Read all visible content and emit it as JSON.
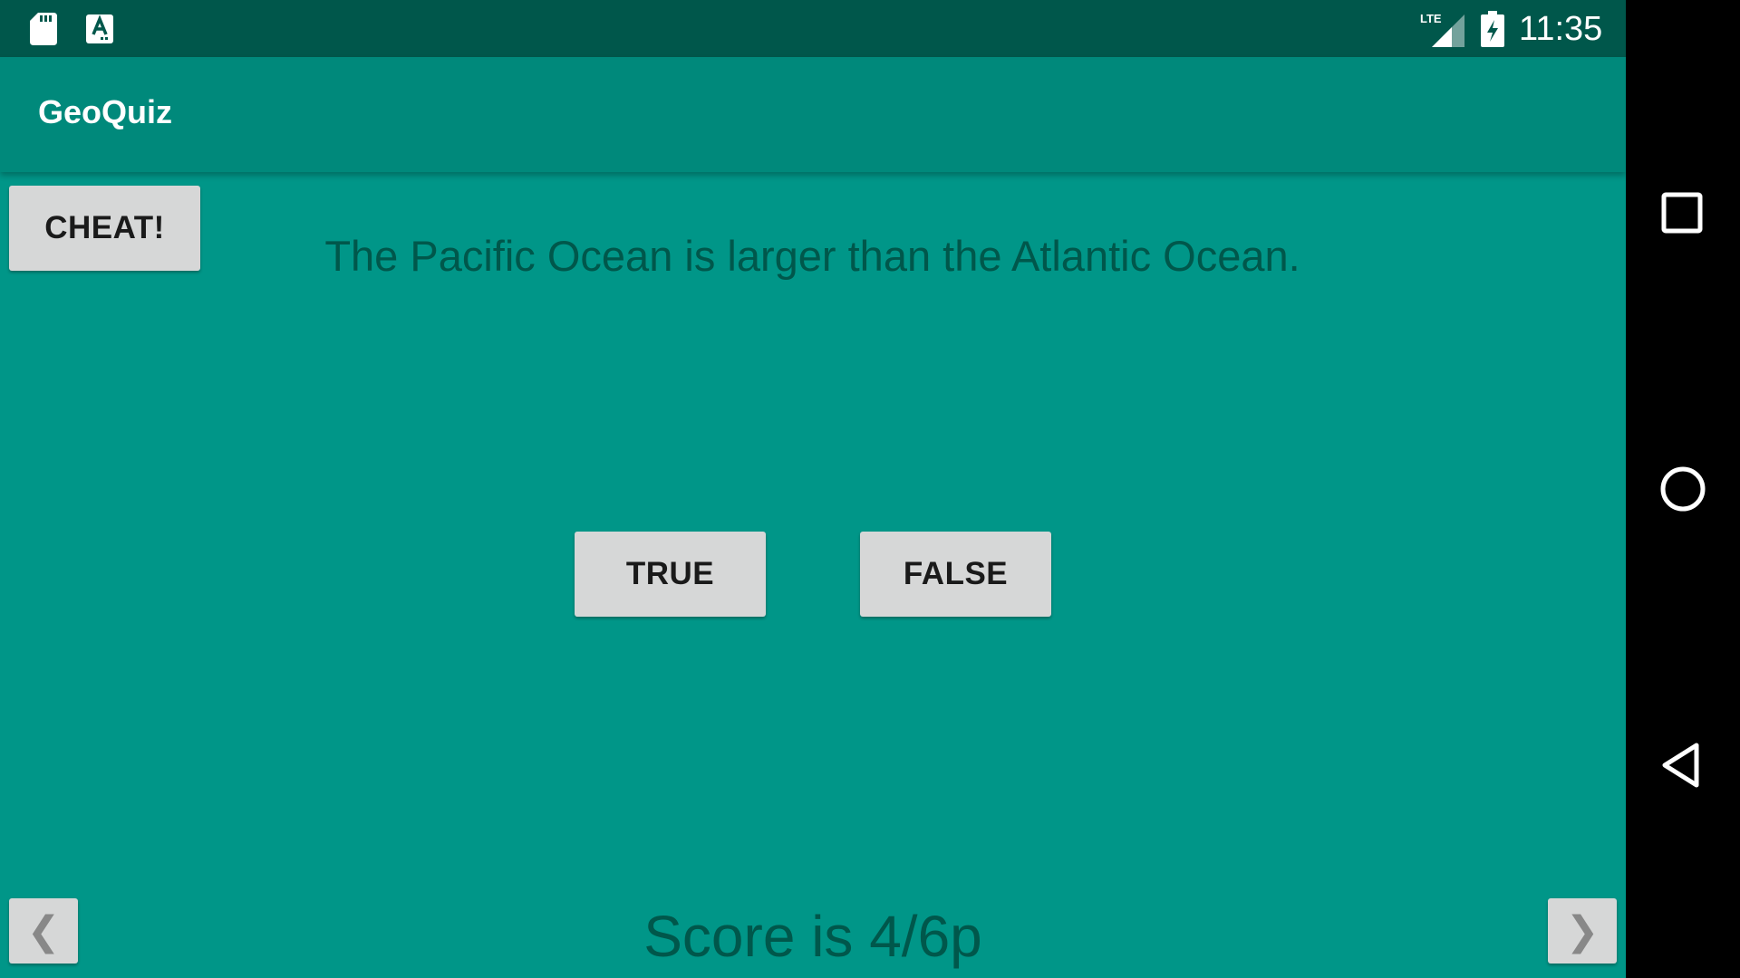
{
  "status_bar": {
    "time": "11:35",
    "network_label": "LTE",
    "icons": [
      "sd-card-icon",
      "text-a-icon",
      "lte-signal-icon",
      "battery-charging-icon"
    ]
  },
  "app_bar": {
    "title": "GeoQuiz"
  },
  "main": {
    "cheat_label": "CHEAT!",
    "question": "The Pacific Ocean is larger than the Atlantic Ocean.",
    "true_label": "TRUE",
    "false_label": "FALSE",
    "prev_glyph": "❮",
    "next_glyph": "❯",
    "score": "Score is 4/6p"
  },
  "nav_bar": {
    "buttons": [
      "recents-icon",
      "home-icon",
      "back-icon"
    ]
  },
  "colors": {
    "status_bar": "#00574B",
    "app_bar": "#00897B",
    "background": "#009688",
    "button": "#D6D7D7",
    "dark_teal_text": "#00574B"
  }
}
